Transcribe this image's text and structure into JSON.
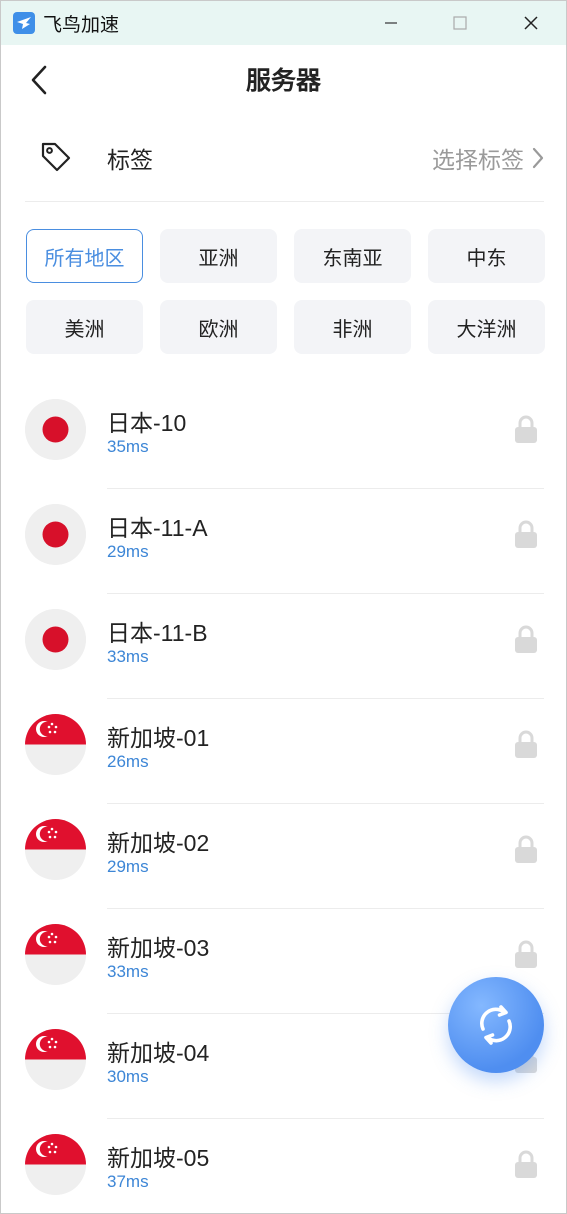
{
  "window": {
    "title": "飞鸟加速",
    "minimize": "—",
    "maximize": "☐",
    "close": "✕"
  },
  "header": {
    "title": "服务器"
  },
  "tag_row": {
    "label": "标签",
    "select_label": "选择标签"
  },
  "regions": [
    {
      "label": "所有地区",
      "active": true
    },
    {
      "label": "亚洲",
      "active": false
    },
    {
      "label": "东南亚",
      "active": false
    },
    {
      "label": "中东",
      "active": false
    },
    {
      "label": "美洲",
      "active": false
    },
    {
      "label": "欧洲",
      "active": false
    },
    {
      "label": "非洲",
      "active": false
    },
    {
      "label": "大洋洲",
      "active": false
    }
  ],
  "servers": [
    {
      "name": "日本-10",
      "ping": "35ms",
      "flag": "japan-flag-icon"
    },
    {
      "name": "日本-11-A",
      "ping": "29ms",
      "flag": "japan-flag-icon"
    },
    {
      "name": "日本-11-B",
      "ping": "33ms",
      "flag": "japan-flag-icon"
    },
    {
      "name": "新加坡-01",
      "ping": "26ms",
      "flag": "singapore-flag-icon"
    },
    {
      "name": "新加坡-02",
      "ping": "29ms",
      "flag": "singapore-flag-icon"
    },
    {
      "name": "新加坡-03",
      "ping": "33ms",
      "flag": "singapore-flag-icon"
    },
    {
      "name": "新加坡-04",
      "ping": "30ms",
      "flag": "singapore-flag-icon"
    },
    {
      "name": "新加坡-05",
      "ping": "37ms",
      "flag": "singapore-flag-icon"
    }
  ],
  "colors": {
    "accent": "#4a8ee0",
    "ping": "#3d86d6",
    "japan_red": "#d7102a",
    "singapore_red": "#e0102e",
    "lock_gray": "#d9d9d9",
    "titlebar_bg": "#e8f6f3"
  },
  "fab": {
    "icon": "refresh-icon"
  }
}
